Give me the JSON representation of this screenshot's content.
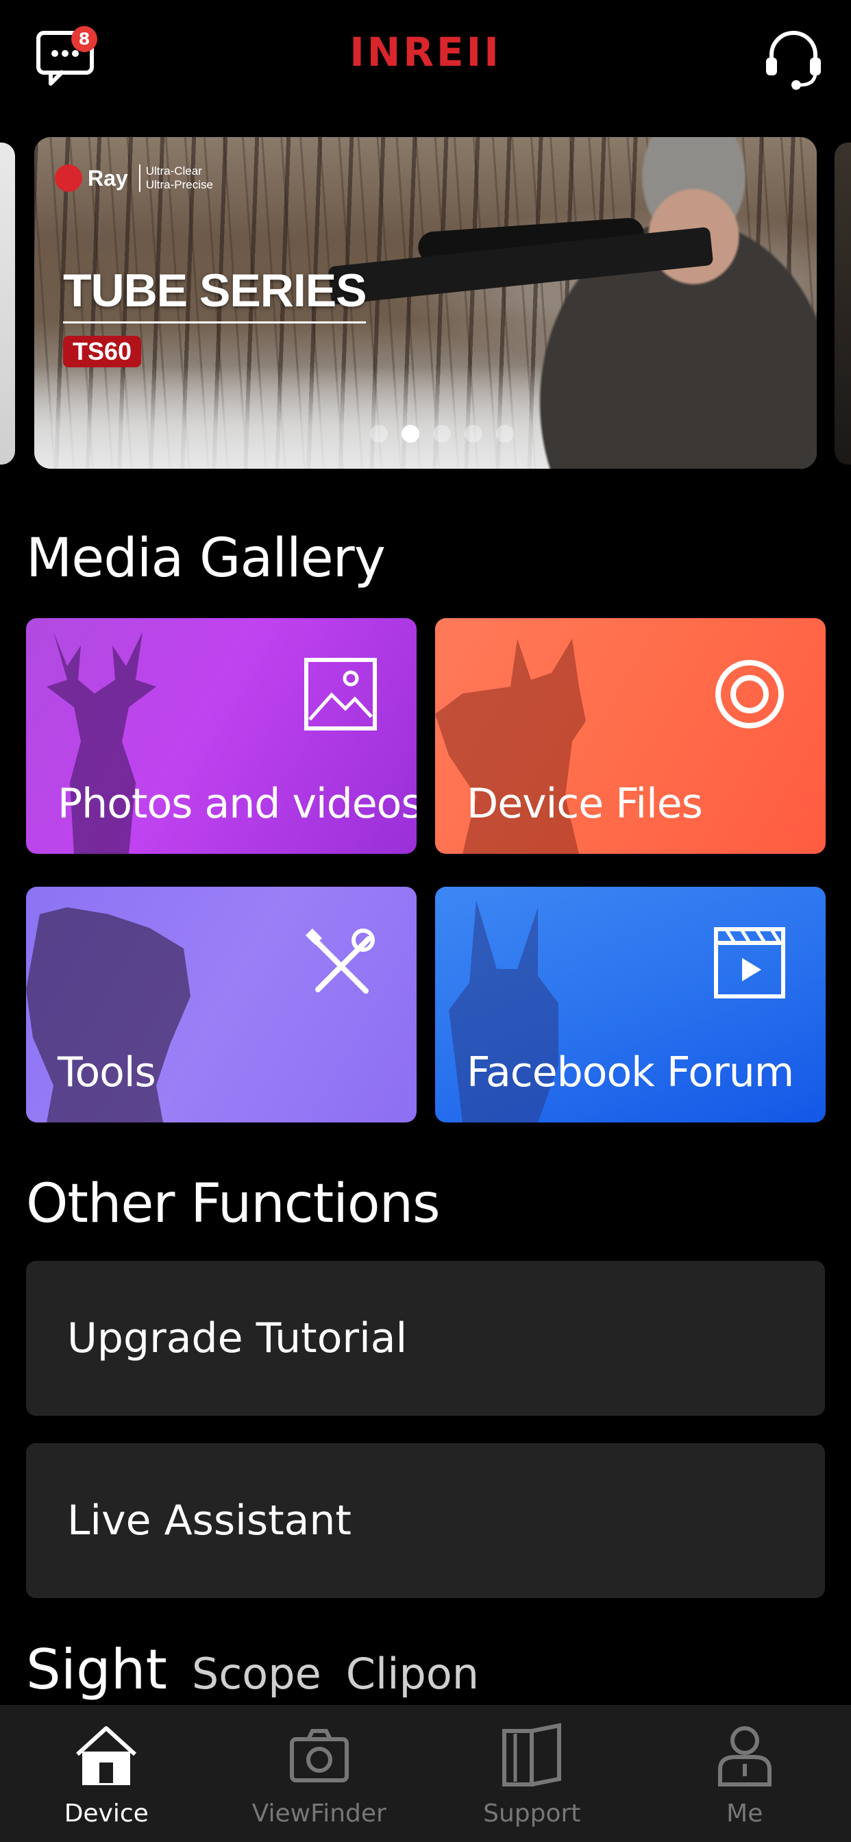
{
  "header": {
    "brand": "INREII",
    "message_badge_count": "8",
    "icons": [
      "chat-icon",
      "headset-icon"
    ]
  },
  "banner": {
    "logo_text": "Ray",
    "logo_sub": "Ultra-Clear\nUltra-Precise",
    "title": "TUBE SERIES",
    "model": "TS60",
    "slide_count": 5,
    "active_slide": 1
  },
  "media_gallery": {
    "title": "Media Gallery",
    "tiles": [
      {
        "label": "Photos and videos",
        "icon": "image-icon",
        "color": "#b14be0"
      },
      {
        "label": "Device Files",
        "icon": "target-icon",
        "color": "#ff6d4a"
      },
      {
        "label": "Tools",
        "icon": "tools-icon",
        "color": "#8c73f2"
      },
      {
        "label": "Facebook Forum",
        "icon": "video-icon",
        "color": "#2a73ee"
      }
    ]
  },
  "other_functions": {
    "title": "Other Functions",
    "items": [
      {
        "label": "Upgrade Tutorial"
      },
      {
        "label": "Live Assistant"
      }
    ]
  },
  "category_tabs": [
    {
      "label": "Sight",
      "active": true
    },
    {
      "label": "Scope",
      "active": false
    },
    {
      "label": "Clipon",
      "active": false
    }
  ],
  "bottom_nav": [
    {
      "label": "Device",
      "icon": "home-icon",
      "active": true
    },
    {
      "label": "ViewFinder",
      "icon": "camera-icon",
      "active": false
    },
    {
      "label": "Support",
      "icon": "book-icon",
      "active": false
    },
    {
      "label": "Me",
      "icon": "person-icon",
      "active": false
    }
  ],
  "colors": {
    "brand": "#d8262c",
    "background": "#000000",
    "card": "#232323",
    "nav_bg": "#1c1c1c"
  }
}
